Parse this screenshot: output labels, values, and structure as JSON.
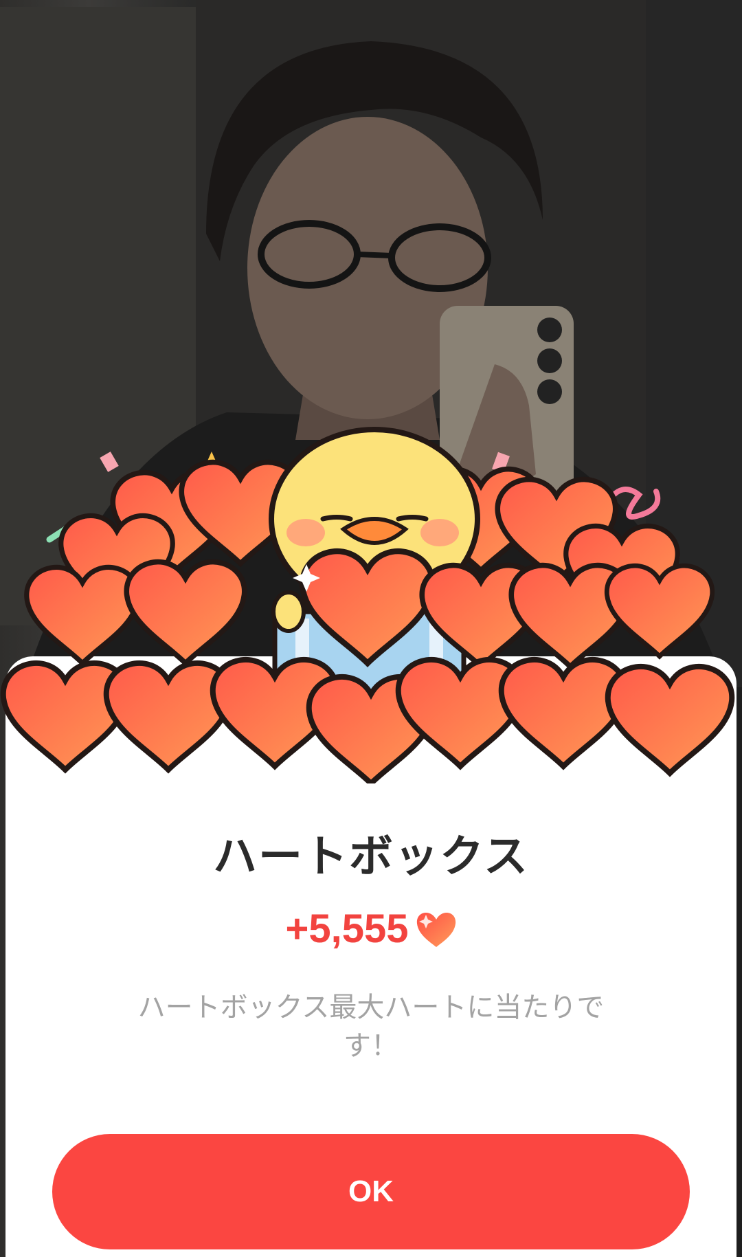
{
  "dialog": {
    "title": "ハートボックス",
    "reward_amount": "+5,555",
    "message": "ハートボックス最大ハートに当たりです！",
    "ok_label": "OK"
  },
  "colors": {
    "accent": "#fb4641",
    "reward_text": "#f2433f",
    "heart": "#f7553f",
    "heart_light": "#ff9a55",
    "chick": "#fce27a",
    "message_text": "#a3a3a3",
    "title_text": "#2b2b2b"
  },
  "icons": {
    "reward": "heart-icon",
    "mascot": "chick-holding-heart-illustration"
  }
}
